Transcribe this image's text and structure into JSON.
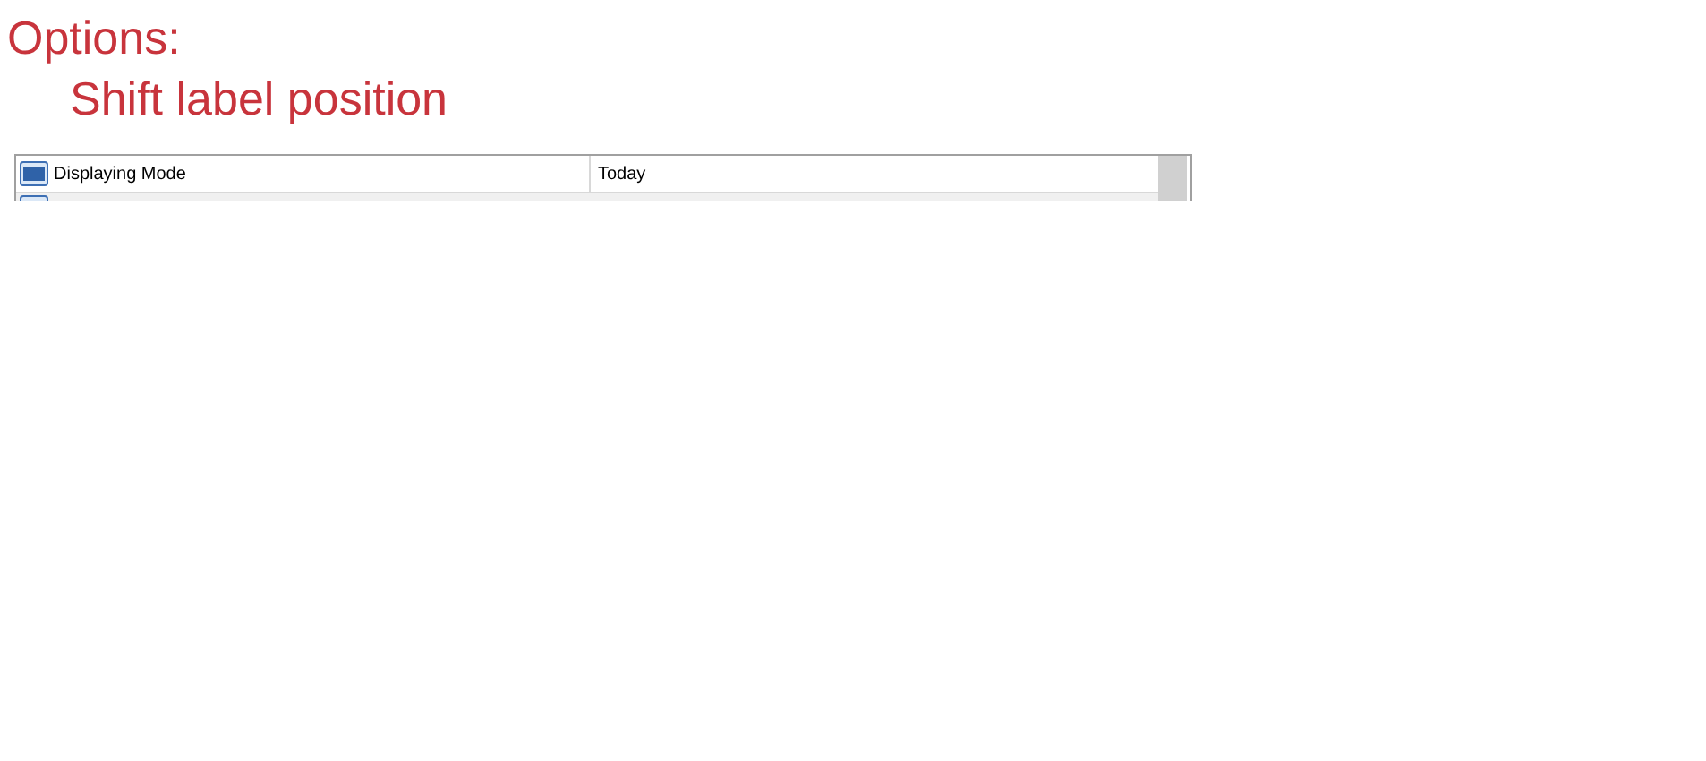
{
  "heading": "Options:",
  "subheading": "Shift label position",
  "table": {
    "rows": [
      {
        "property": "Displaying Mode",
        "value": "Today"
      }
    ]
  }
}
